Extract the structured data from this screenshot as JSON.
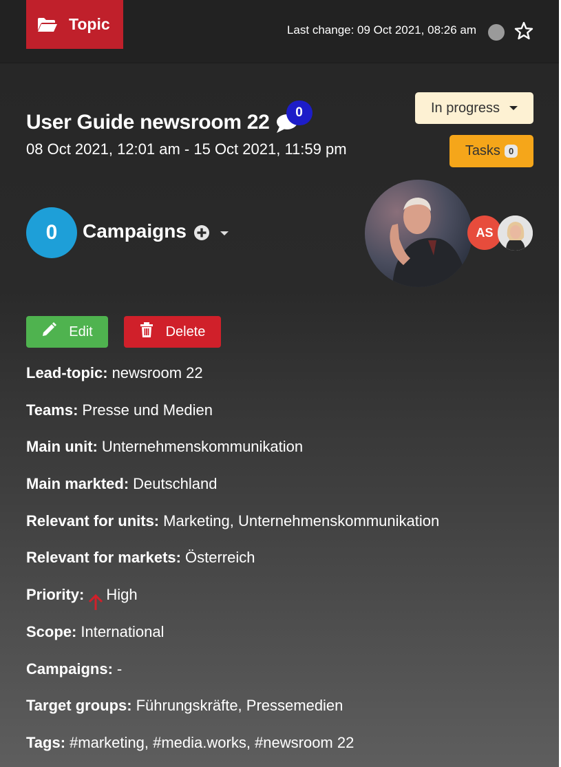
{
  "header": {
    "tag_label": "Topic",
    "last_change": "Last change: 09 Oct 2021, 08:26 am"
  },
  "topic": {
    "title": "User Guide newsroom 22",
    "comment_count": "0",
    "date_range": "08 Oct 2021, 12:01 am - 15 Oct 2021, 11:59 pm",
    "status": "In progress",
    "tasks_label": "Tasks",
    "tasks_count": "0"
  },
  "campaigns": {
    "count": "0",
    "label": "Campaigns"
  },
  "assignees": {
    "initials": "AS"
  },
  "actions": {
    "edit_label": "Edit",
    "delete_label": "Delete"
  },
  "details": [
    {
      "label": "Lead-topic:",
      "value": "newsroom 22"
    },
    {
      "label": "Teams:",
      "value": "Presse und Medien"
    },
    {
      "label": "Main unit:",
      "value": "Unternehmenskommunikation"
    },
    {
      "label": "Main markted:",
      "value": "Deutschland"
    },
    {
      "label": "Relevant for units:",
      "value": "Marketing, Unternehmenskommunikation"
    },
    {
      "label": "Relevant for markets:",
      "value": "Österreich"
    },
    {
      "label": "Priority:",
      "value": "High"
    },
    {
      "label": "Scope:",
      "value": "International"
    },
    {
      "label": "Campaigns:",
      "value": "-"
    },
    {
      "label": "Target groups:",
      "value": "Führungskräfte, Pressemedien"
    },
    {
      "label": "Tags:",
      "value": "#marketing, #media.works, #newsroom 22"
    }
  ],
  "colors": {
    "topic_tag": "#c0202b",
    "comment_badge": "#1d1dc8",
    "status_button": "#fdf1d3",
    "tasks_button": "#f5a61a",
    "campaign_circle": "#1e9fd8",
    "edit_button": "#4fb34f",
    "delete_button": "#d0202a",
    "priority_high": "#d0202a"
  },
  "icons": {
    "topic": "folder-open-icon",
    "status": "status-dot-icon",
    "favorite": "star-outline-icon",
    "comments": "comment-icon",
    "add_campaign": "plus-circle-icon",
    "edit": "pencil-icon",
    "delete": "trash-icon",
    "priority": "arrow-up-icon"
  }
}
